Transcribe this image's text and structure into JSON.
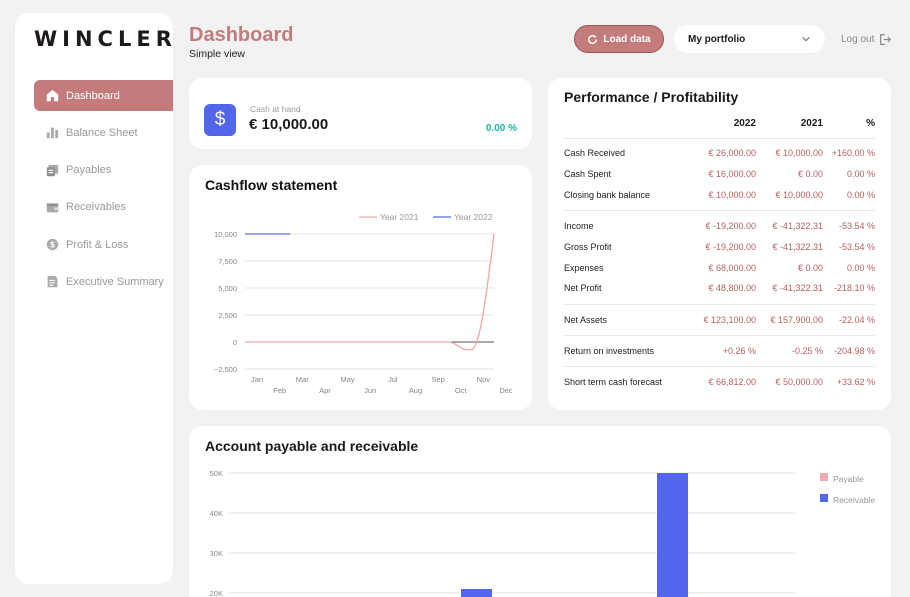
{
  "app": {
    "logo": "WINCLER"
  },
  "header": {
    "title": "Dashboard",
    "subtitle": "Simple view",
    "load_button": "Load data",
    "portfolio_select": "My portfolio",
    "logout": "Log out"
  },
  "sidebar": {
    "items": [
      {
        "label": "Dashboard",
        "icon": "home-icon",
        "active": true
      },
      {
        "label": "Balance Sheet",
        "icon": "bar-chart-icon",
        "active": false
      },
      {
        "label": "Payables",
        "icon": "payables-icon",
        "active": false
      },
      {
        "label": "Receivables",
        "icon": "wallet-icon",
        "active": false
      },
      {
        "label": "Profit & Loss",
        "icon": "dollar-coin-icon",
        "active": false
      },
      {
        "label": "Executive Summary",
        "icon": "document-icon",
        "active": false
      }
    ]
  },
  "cash_at_hand": {
    "label": "Cash at hand",
    "value": "€ 10,000.00",
    "change": "0.00 %",
    "icon": "dollar-icon",
    "icon_glyph": "$"
  },
  "cashflow": {
    "title": "Cashflow statement",
    "legend": [
      "Year 2021",
      "Year 2022"
    ],
    "colors": {
      "year_2021": "#f0a8a8",
      "year_2022": "#5a6fe0"
    },
    "y_ticks": [
      "10,000",
      "7,500",
      "5,000",
      "2,500",
      "0",
      "−2,500"
    ],
    "x_ticks_top": [
      "Jan",
      "Mar",
      "May",
      "Jul",
      "Sep",
      "Nov"
    ],
    "x_ticks_bottom": [
      "Feb",
      "Apr",
      "Jun",
      "Aug",
      "Oct",
      "Dec"
    ]
  },
  "chart_data": [
    {
      "type": "line",
      "title": "Cashflow statement",
      "categories": [
        "Jan",
        "Feb",
        "Mar",
        "Apr",
        "May",
        "Jun",
        "Jul",
        "Aug",
        "Sep",
        "Oct",
        "Nov",
        "Dec"
      ],
      "ylim": [
        -2500,
        10000
      ],
      "series": [
        {
          "name": "Year 2021",
          "values": [
            0,
            0,
            0,
            0,
            0,
            0,
            0,
            0,
            0,
            0,
            -700,
            10000
          ]
        },
        {
          "name": "Year 2022",
          "values": [
            10000,
            10000,
            10000,
            null,
            null,
            null,
            null,
            null,
            null,
            null,
            null,
            null
          ]
        }
      ],
      "legend_position": "top-right",
      "grid": true
    },
    {
      "type": "bar",
      "title": "Account payable and receivable",
      "y_ticks": [
        "50K",
        "40K",
        "30K",
        "20K"
      ],
      "ylim": [
        20000,
        50000
      ],
      "series": [
        {
          "name": "Payable",
          "values": []
        },
        {
          "name": "Receivable",
          "values": [
            21000,
            50000
          ]
        }
      ],
      "legend_position": "right"
    }
  ],
  "performance": {
    "title": "Performance / Profitability",
    "columns": [
      "2022",
      "2021",
      "%"
    ],
    "rows": [
      {
        "label": "Cash Received",
        "v2022": "€ 26,000.00",
        "v2021": "€ 10,000.00",
        "pct": "+160.00 %"
      },
      {
        "label": "Cash Spent",
        "v2022": "€ 16,000.00",
        "v2021": "€ 0.00",
        "pct": "0.00 %"
      },
      {
        "label": "Closing bank balance",
        "v2022": "€ 10,000.00",
        "v2021": "€ 10,000.00",
        "pct": "0.00 %"
      },
      {
        "label": "Income",
        "v2022": "€ -19,200.00",
        "v2021": "€ -41,322.31",
        "pct": "-53.54 %"
      },
      {
        "label": "Gross Profit",
        "v2022": "€ -19,200.00",
        "v2021": "€ -41,322.31",
        "pct": "-53.54 %"
      },
      {
        "label": "Expenses",
        "v2022": "€ 68,000.00",
        "v2021": "€ 0.00",
        "pct": "0.00 %"
      },
      {
        "label": "Net Profit",
        "v2022": "€ 48,800.00",
        "v2021": "€ -41,322.31",
        "pct": "-218.10 %"
      },
      {
        "label": "Net Assets",
        "v2022": "€ 123,100.00",
        "v2021": "€ 157,900.00",
        "pct": "-22.04 %"
      },
      {
        "label": "Return on investments",
        "v2022": "+0.26 %",
        "v2021": "-0.25 %",
        "pct": "-204.98 %"
      },
      {
        "label": "Short term cash forecast",
        "v2022": "€ 66,812.00",
        "v2021": "€ 50,000.00",
        "pct": "+33.62 %"
      }
    ]
  },
  "apr": {
    "title": "Account payable and receivable",
    "y_ticks": [
      "50K",
      "40K",
      "30K",
      "20K"
    ],
    "legend": [
      "Payable",
      "Receivable"
    ],
    "colors": {
      "payable": "#f5a9ad",
      "receivable": "#5266ee"
    }
  }
}
